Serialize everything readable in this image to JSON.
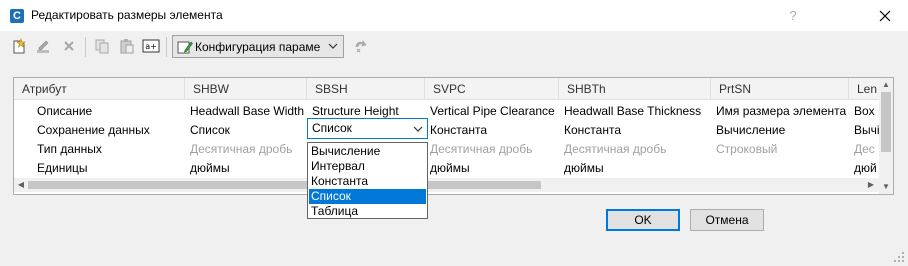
{
  "window": {
    "title": "Редактировать размеры элемента",
    "app_icon_letter": "C",
    "help": "?",
    "accent": "#0078d7"
  },
  "toolbar": {
    "icons": [
      "new-icon",
      "edit-icon",
      "delete-icon",
      "copy-icon",
      "paste-icon",
      "rename-icon",
      "refresh-icon"
    ],
    "config_combo": "Конфигурация параме"
  },
  "grid": {
    "columns": [
      "Атрибут",
      "SHBW",
      "SBSH",
      "SVPC",
      "SHBTh",
      "PrtSN",
      "Len"
    ],
    "rows": [
      {
        "label": "Описание",
        "cells": [
          "Headwall Base Width",
          "Structure Height",
          "Vertical Pipe Clearance",
          "Headwall Base Thickness",
          "Имя размера элемента",
          "Box"
        ]
      },
      {
        "label": "Сохранение данных",
        "cells": [
          "Список",
          "Список",
          "Константа",
          "Константа",
          "Вычисление",
          "Вычі"
        ]
      },
      {
        "label": "Тип данных",
        "cells": [
          "Десятичная дробь",
          "",
          "Десятичная дробь",
          "Десятичная дробь",
          "Строковый",
          "Дес"
        ]
      },
      {
        "label": "Единицы",
        "cells": [
          "дюймы",
          "",
          "дюймы",
          "дюймы",
          "",
          "дюй"
        ]
      }
    ]
  },
  "dropdown": {
    "options": [
      "Вычисление",
      "Интервал",
      "Константа",
      "Список",
      "Таблица"
    ],
    "selected": "Список"
  },
  "buttons": {
    "ok": "OK",
    "cancel": "Отмена"
  }
}
